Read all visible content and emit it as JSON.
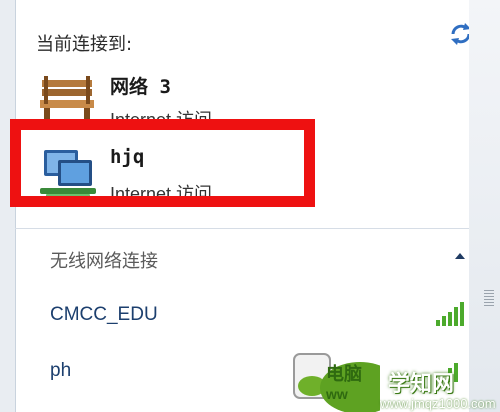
{
  "panel": {
    "header": "当前连接到:",
    "connections": [
      {
        "name": "网络  3",
        "status": "Internet 访问",
        "icon": "public-network-bench-icon"
      },
      {
        "name": "hjq",
        "status": "Internet 访问",
        "icon": "home-network-computer-icon"
      }
    ],
    "wireless": {
      "header": "无线网络连接",
      "networks": [
        {
          "ssid": "CMCC_EDU",
          "signal_icon": "signal-strength-icon"
        },
        {
          "ssid": "ph",
          "signal_icon": "signal-strength-icon"
        }
      ]
    }
  },
  "watermark": {
    "site_name": "学知网",
    "url": "www.jmqz1000.com",
    "partial_text": "电脑",
    "partial_text2": "ww"
  },
  "colors": {
    "highlight": "#ee1111",
    "link": "#1c3f6e",
    "watermark_green": "#4c9a1a"
  }
}
